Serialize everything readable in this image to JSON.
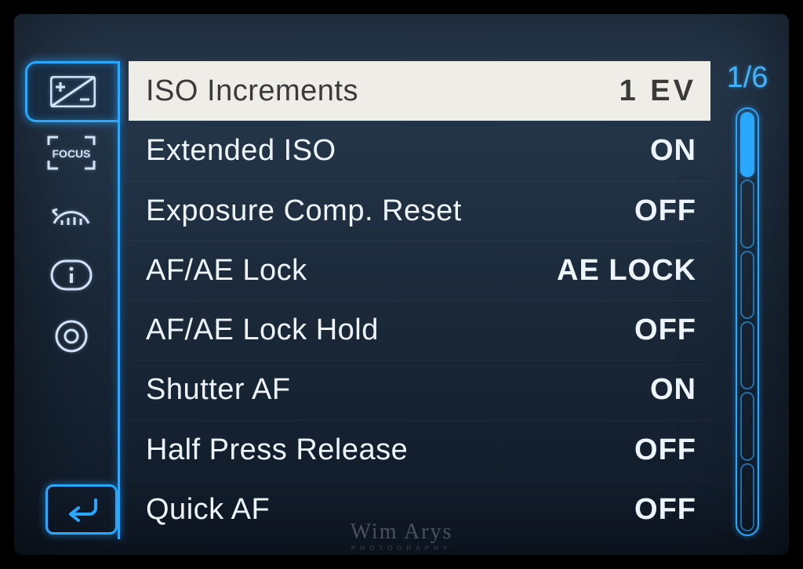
{
  "page_indicator": "1/6",
  "sidebar": {
    "tabs": [
      {
        "id": "exposure",
        "active": true
      },
      {
        "id": "focus",
        "active": false
      },
      {
        "id": "dial",
        "active": false
      },
      {
        "id": "info",
        "active": false
      },
      {
        "id": "lens",
        "active": false
      }
    ]
  },
  "menu": {
    "items": [
      {
        "label": "ISO Increments",
        "value": "1 EV",
        "selected": true
      },
      {
        "label": "Extended ISO",
        "value": "ON",
        "selected": false
      },
      {
        "label": "Exposure Comp. Reset",
        "value": "OFF",
        "selected": false
      },
      {
        "label": "AF/AE Lock",
        "value": "AE LOCK",
        "selected": false
      },
      {
        "label": "AF/AE Lock Hold",
        "value": "OFF",
        "selected": false
      },
      {
        "label": "Shutter AF",
        "value": "ON",
        "selected": false
      },
      {
        "label": "Half Press Release",
        "value": "OFF",
        "selected": false
      },
      {
        "label": "Quick AF",
        "value": "OFF",
        "selected": false
      }
    ]
  },
  "scrollbar": {
    "segments": 6,
    "filled_index": 0
  },
  "watermark": {
    "main": "Wim Arys",
    "sub": "PHOTOGRAPHY"
  }
}
